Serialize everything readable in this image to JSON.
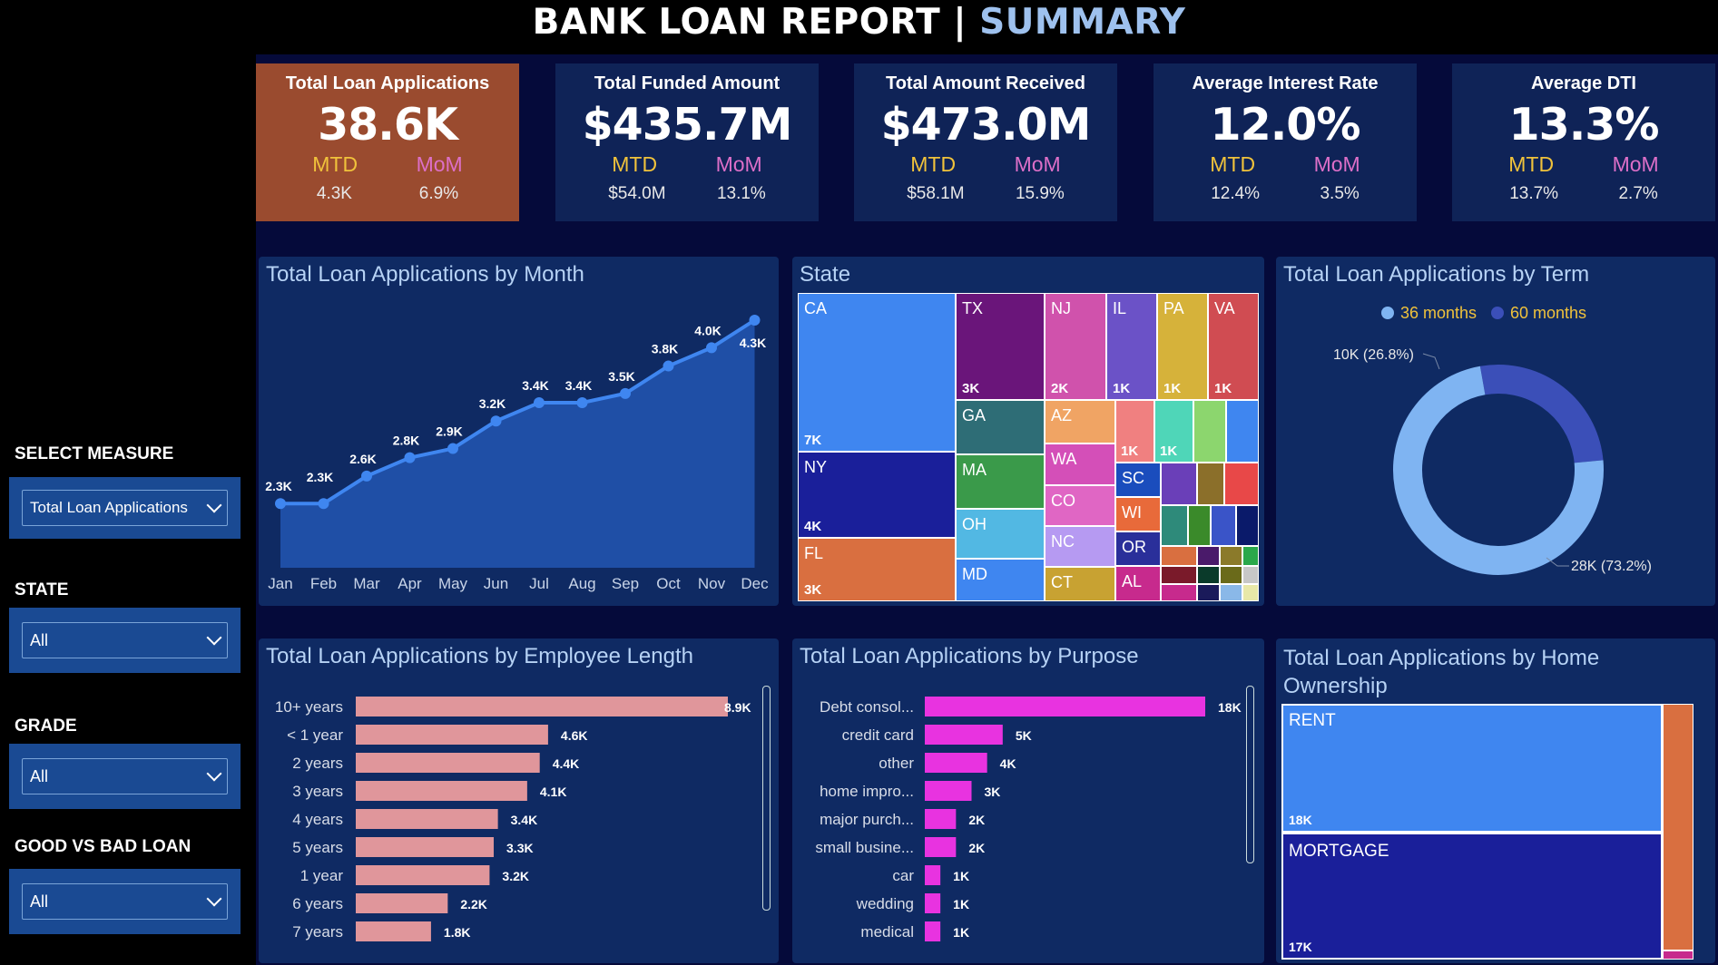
{
  "header": {
    "title_main": "BANK LOAN REPORT | ",
    "title_accent": "SUMMARY"
  },
  "kpis": [
    {
      "label": "Total Loan Applications",
      "value": "38.6K",
      "mtd_label": "MTD",
      "mom_label": "MoM",
      "mtd": "4.3K",
      "mom": "6.9%"
    },
    {
      "label": "Total Funded Amount",
      "value": "$435.7M",
      "mtd_label": "MTD",
      "mom_label": "MoM",
      "mtd": "$54.0M",
      "mom": "13.1%"
    },
    {
      "label": "Total Amount Received",
      "value": "$473.0M",
      "mtd_label": "MTD",
      "mom_label": "MoM",
      "mtd": "$58.1M",
      "mom": "15.9%"
    },
    {
      "label": "Average Interest Rate",
      "value": "12.0%",
      "mtd_label": "MTD",
      "mom_label": "MoM",
      "mtd": "12.4%",
      "mom": "3.5%"
    },
    {
      "label": "Average DTI",
      "value": "13.3%",
      "mtd_label": "MTD",
      "mom_label": "MoM",
      "mtd": "13.7%",
      "mom": "2.7%"
    }
  ],
  "filters": {
    "measure_label": "SELECT MEASURE",
    "measure_value": "Total Loan Applications",
    "state_label": "STATE",
    "state_value": "All",
    "grade_label": "GRADE",
    "grade_value": "All",
    "goodbad_label": "GOOD VS BAD LOAN",
    "goodbad_value": "All"
  },
  "panels": {
    "month_title": "Total Loan Applications by Month",
    "state_title": "State",
    "term_title": "Total Loan Applications by Term",
    "emp_title": "Total Loan Applications by Employee Length",
    "purpose_title": "Total Loan Applications by Purpose",
    "home_title": "Total Loan Applications by Home Ownership"
  },
  "chart_data": [
    {
      "type": "area",
      "title": "Total Loan Applications by Month",
      "categories": [
        "Jan",
        "Feb",
        "Mar",
        "Apr",
        "May",
        "Jun",
        "Jul",
        "Aug",
        "Sep",
        "Oct",
        "Nov",
        "Dec"
      ],
      "values": [
        2.3,
        2.3,
        2.6,
        2.8,
        2.9,
        3.2,
        3.4,
        3.4,
        3.5,
        3.8,
        4.0,
        4.3
      ],
      "labels": [
        "2.3K",
        "2.3K",
        "2.6K",
        "2.8K",
        "2.9K",
        "3.2K",
        "3.4K",
        "3.4K",
        "3.5K",
        "3.8K",
        "4.0K",
        "4.3K"
      ],
      "units": "K"
    },
    {
      "type": "pie",
      "title": "Total Loan Applications by Term",
      "legend": [
        "36 months",
        "60 months"
      ],
      "legend_position": "top",
      "values": [
        28,
        10
      ],
      "labels": [
        "28K (73.2%)",
        "10K (26.8%)"
      ],
      "colors": [
        "#7fb4f2",
        "#3b4fb8"
      ]
    },
    {
      "type": "bar",
      "title": "Total Loan Applications by Employee Length",
      "categories": [
        "10+ years",
        "< 1 year",
        "2 years",
        "3 years",
        "4 years",
        "5 years",
        "1 year",
        "6 years",
        "7 years"
      ],
      "values": [
        8.9,
        4.6,
        4.4,
        4.1,
        3.4,
        3.3,
        3.2,
        2.2,
        1.8
      ],
      "labels": [
        "8.9K",
        "4.6K",
        "4.4K",
        "4.1K",
        "3.4K",
        "3.3K",
        "3.2K",
        "2.2K",
        "1.8K"
      ],
      "color": "#e0969b"
    },
    {
      "type": "bar",
      "title": "Total Loan Applications by Purpose",
      "categories": [
        "Debt consol...",
        "credit card",
        "other",
        "home impro...",
        "major purch...",
        "small busine...",
        "car",
        "wedding",
        "medical"
      ],
      "values": [
        18,
        5,
        4,
        3,
        2,
        2,
        1,
        1,
        1
      ],
      "labels": [
        "18K",
        "5K",
        "4K",
        "3K",
        "2K",
        "2K",
        "1K",
        "1K",
        "1K"
      ],
      "color": "#e833e0"
    }
  ],
  "state_treemap": [
    {
      "name": "CA",
      "value": "7K",
      "color": "#3f86f0"
    },
    {
      "name": "NY",
      "value": "4K",
      "color": "#1a1f9a"
    },
    {
      "name": "FL",
      "value": "3K",
      "color": "#d96f40"
    },
    {
      "name": "TX",
      "value": "3K",
      "color": "#6a157a"
    },
    {
      "name": "NJ",
      "value": "2K",
      "color": "#d052ac"
    },
    {
      "name": "IL",
      "value": "1K",
      "color": "#6b52c7"
    },
    {
      "name": "PA",
      "value": "1K",
      "color": "#d6b23a"
    },
    {
      "name": "VA",
      "value": "1K",
      "color": "#d04c52"
    },
    {
      "name": "GA",
      "value": "",
      "color": "#2e6d76"
    },
    {
      "name": "MA",
      "value": "",
      "color": "#3a9a4a"
    },
    {
      "name": "OH",
      "value": "",
      "color": "#52b8e3"
    },
    {
      "name": "MD",
      "value": "",
      "color": "#3f86f0"
    },
    {
      "name": "AZ",
      "value": "",
      "color": "#f0a464"
    },
    {
      "name": "WA",
      "value": "",
      "color": "#d44fb8"
    },
    {
      "name": "CO",
      "value": "",
      "color": "#e066c4"
    },
    {
      "name": "NC",
      "value": "",
      "color": "#b69af2"
    },
    {
      "name": "CT",
      "value": "",
      "color": "#c8a232"
    },
    {
      "name": "SC",
      "value": "",
      "color": "#1a4dbd"
    },
    {
      "name": "WI",
      "value": "",
      "color": "#e86a3a"
    },
    {
      "name": "OR",
      "value": "",
      "color": "#2a2f9a"
    },
    {
      "name": "AL",
      "value": "",
      "color": "#c72a8d"
    }
  ],
  "home_treemap": [
    {
      "name": "RENT",
      "value": "18K",
      "color": "#3f86f0"
    },
    {
      "name": "MORTGAGE",
      "value": "17K",
      "color": "#1a1f9a"
    }
  ]
}
